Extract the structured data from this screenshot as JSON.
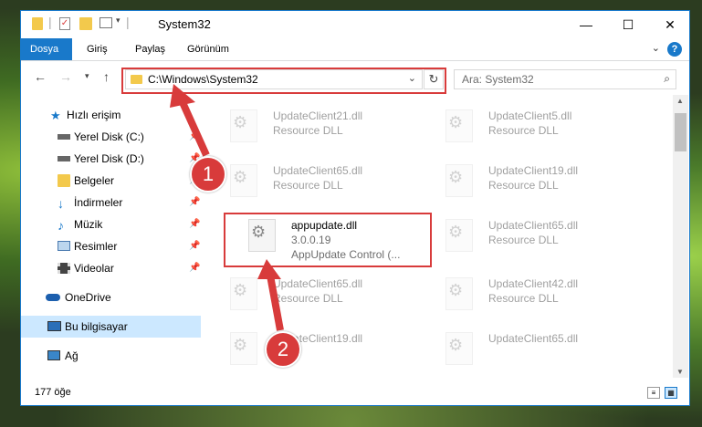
{
  "window": {
    "title": "System32"
  },
  "ribbon": {
    "tabs": [
      {
        "label": "Dosya",
        "active": true
      },
      {
        "label": "Giriş"
      },
      {
        "label": "Paylaş"
      },
      {
        "label": "Görünüm"
      }
    ],
    "help": "?"
  },
  "nav": {
    "address": "C:\\Windows\\System32",
    "search_placeholder": "Ara: System32"
  },
  "sidebar": {
    "items": [
      {
        "label": "Hızlı erişim",
        "icon": "star-icon"
      },
      {
        "label": "Yerel Disk (C:)",
        "icon": "drive-icon",
        "pinned": true
      },
      {
        "label": "Yerel Disk (D:)",
        "icon": "drive-icon",
        "pinned": true
      },
      {
        "label": "Belgeler",
        "icon": "documents-icon",
        "pinned": true
      },
      {
        "label": "İndirmeler",
        "icon": "downloads-icon",
        "pinned": true
      },
      {
        "label": "Müzik",
        "icon": "music-icon",
        "pinned": true
      },
      {
        "label": "Resimler",
        "icon": "pictures-icon",
        "pinned": true
      },
      {
        "label": "Videolar",
        "icon": "videos-icon",
        "pinned": true
      },
      {
        "label": "OneDrive",
        "icon": "cloud-icon"
      },
      {
        "label": "Bu bilgisayar",
        "icon": "computer-icon",
        "selected": true
      },
      {
        "label": "Ağ",
        "icon": "network-icon"
      }
    ]
  },
  "files": [
    {
      "name": "UpdateClient21.dll",
      "desc": "Resource DLL"
    },
    {
      "name": "UpdateClient5.dll",
      "desc": "Resource DLL"
    },
    {
      "name": "UpdateClient65.dll",
      "desc": "Resource DLL"
    },
    {
      "name": "UpdateClient19.dll",
      "desc": "Resource DLL"
    },
    {
      "name": "appupdate.dll",
      "version": "3.0.0.19",
      "desc": "AppUpdate Control (..."
    },
    {
      "name": "UpdateClient65.dll",
      "desc": "Resource DLL"
    },
    {
      "name": "UpdateClient65.dll",
      "desc": "Resource DLL"
    },
    {
      "name": "UpdateClient42.dll",
      "desc": "Resource DLL"
    },
    {
      "name": "UpdateClient19.dll",
      "desc": ""
    },
    {
      "name": "UpdateClient65.dll",
      "desc": ""
    }
  ],
  "status": {
    "count": "177 öğe"
  },
  "callouts": [
    "1",
    "2"
  ],
  "colors": {
    "accent": "#1979ca",
    "highlight": "#d83b3b",
    "selected": "#cce8ff"
  }
}
